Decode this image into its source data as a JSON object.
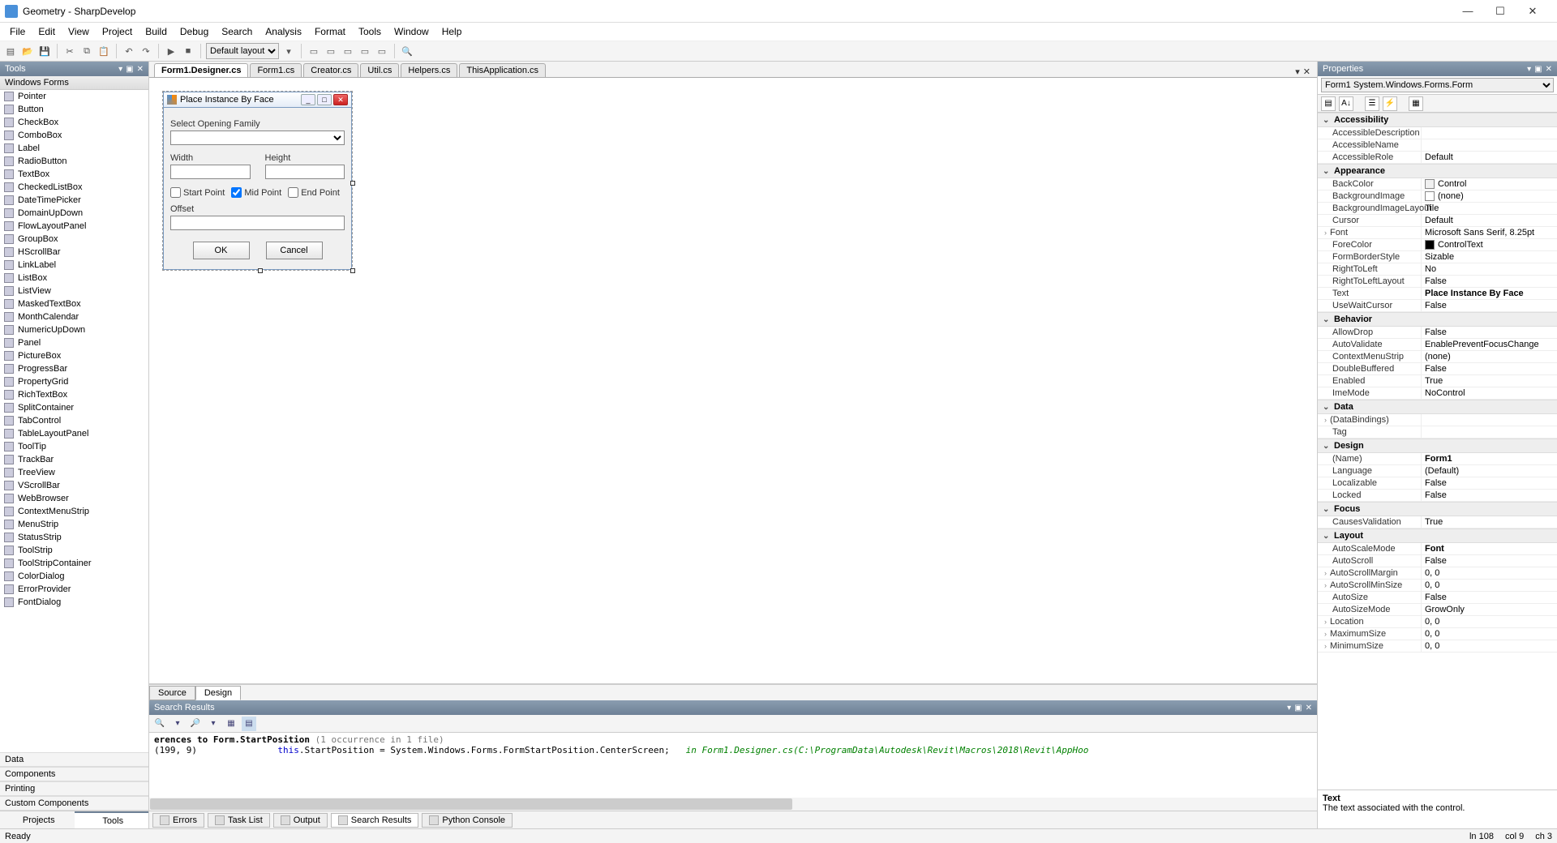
{
  "window": {
    "title": "Geometry - SharpDevelop"
  },
  "menu": [
    "File",
    "Edit",
    "View",
    "Project",
    "Build",
    "Debug",
    "Search",
    "Analysis",
    "Format",
    "Tools",
    "Window",
    "Help"
  ],
  "toolbar": {
    "layout": "Default layout"
  },
  "tools": {
    "header": "Tools",
    "subheader": "Windows Forms",
    "items": [
      "Pointer",
      "Button",
      "CheckBox",
      "ComboBox",
      "Label",
      "RadioButton",
      "TextBox",
      "CheckedListBox",
      "DateTimePicker",
      "DomainUpDown",
      "FlowLayoutPanel",
      "GroupBox",
      "HScrollBar",
      "LinkLabel",
      "ListBox",
      "ListView",
      "MaskedTextBox",
      "MonthCalendar",
      "NumericUpDown",
      "Panel",
      "PictureBox",
      "ProgressBar",
      "PropertyGrid",
      "RichTextBox",
      "SplitContainer",
      "TabControl",
      "TableLayoutPanel",
      "ToolTip",
      "TrackBar",
      "TreeView",
      "VScrollBar",
      "WebBrowser",
      "ContextMenuStrip",
      "MenuStrip",
      "StatusStrip",
      "ToolStrip",
      "ToolStripContainer",
      "ColorDialog",
      "ErrorProvider",
      "FontDialog"
    ],
    "sections": [
      "Data",
      "Components",
      "Printing",
      "Custom Components"
    ],
    "tab_projects": "Projects",
    "tab_tools": "Tools"
  },
  "tabs": {
    "files": [
      "Form1.Designer.cs",
      "Form1.cs",
      "Creator.cs",
      "Util.cs",
      "Helpers.cs",
      "ThisApplication.cs"
    ],
    "active": 0,
    "subtabs": {
      "source": "Source",
      "design": "Design",
      "active": "Design"
    }
  },
  "designer": {
    "title": "Place Instance By Face",
    "lbl_family": "Select Opening Family",
    "lbl_width": "Width",
    "lbl_height": "Height",
    "chk_start": "Start Point",
    "chk_mid": "Mid Point",
    "chk_end": "End Point",
    "lbl_offset": "Offset",
    "btn_ok": "OK",
    "btn_cancel": "Cancel"
  },
  "search": {
    "header": "Search Results",
    "line1_a": "erences to Form.StartPosition",
    "line1_b": " (1 occurrence in 1 file)",
    "line2_pos": "(199, 9)",
    "line2_code_a": "this",
    "line2_code_b": ".StartPosition = System.Windows.Forms.FormStartPosition.CenterScreen;",
    "line2_comment": "in Form1.Designer.cs(C:\\ProgramData\\Autodesk\\Revit\\Macros\\2018\\Revit\\AppHoo"
  },
  "bottomtabs": [
    "Errors",
    "Task List",
    "Output",
    "Search Results",
    "Python Console"
  ],
  "props": {
    "header": "Properties",
    "object": "Form1   System.Windows.Forms.Form",
    "help_title": "Text",
    "help_desc": "The text associated with the control.",
    "cats": {
      "Accessibility": [
        {
          "n": "AccessibleDescription",
          "v": ""
        },
        {
          "n": "AccessibleName",
          "v": ""
        },
        {
          "n": "AccessibleRole",
          "v": "Default"
        }
      ],
      "Appearance": [
        {
          "n": "BackColor",
          "v": "Control",
          "swatch": "#f0f0f0"
        },
        {
          "n": "BackgroundImage",
          "v": "(none)",
          "swatch": "#ffffff"
        },
        {
          "n": "BackgroundImageLayout",
          "v": "Tile"
        },
        {
          "n": "Cursor",
          "v": "Default"
        },
        {
          "n": "Font",
          "v": "Microsoft Sans Serif, 8.25pt",
          "exp": true
        },
        {
          "n": "ForeColor",
          "v": "ControlText",
          "swatch": "#000000"
        },
        {
          "n": "FormBorderStyle",
          "v": "Sizable"
        },
        {
          "n": "RightToLeft",
          "v": "No"
        },
        {
          "n": "RightToLeftLayout",
          "v": "False"
        },
        {
          "n": "Text",
          "v": "Place Instance By Face",
          "bold": true
        },
        {
          "n": "UseWaitCursor",
          "v": "False"
        }
      ],
      "Behavior": [
        {
          "n": "AllowDrop",
          "v": "False"
        },
        {
          "n": "AutoValidate",
          "v": "EnablePreventFocusChange"
        },
        {
          "n": "ContextMenuStrip",
          "v": "(none)"
        },
        {
          "n": "DoubleBuffered",
          "v": "False"
        },
        {
          "n": "Enabled",
          "v": "True"
        },
        {
          "n": "ImeMode",
          "v": "NoControl"
        }
      ],
      "Data": [
        {
          "n": "(DataBindings)",
          "v": "",
          "exp": true
        },
        {
          "n": "Tag",
          "v": ""
        }
      ],
      "Design": [
        {
          "n": "(Name)",
          "v": "Form1",
          "bold": true
        },
        {
          "n": "Language",
          "v": "(Default)"
        },
        {
          "n": "Localizable",
          "v": "False"
        },
        {
          "n": "Locked",
          "v": "False"
        }
      ],
      "Focus": [
        {
          "n": "CausesValidation",
          "v": "True"
        }
      ],
      "Layout": [
        {
          "n": "AutoScaleMode",
          "v": "Font",
          "bold": true
        },
        {
          "n": "AutoScroll",
          "v": "False"
        },
        {
          "n": "AutoScrollMargin",
          "v": "0, 0",
          "exp": true
        },
        {
          "n": "AutoScrollMinSize",
          "v": "0, 0",
          "exp": true
        },
        {
          "n": "AutoSize",
          "v": "False"
        },
        {
          "n": "AutoSizeMode",
          "v": "GrowOnly"
        },
        {
          "n": "Location",
          "v": "0, 0",
          "exp": true
        },
        {
          "n": "MaximumSize",
          "v": "0, 0",
          "exp": true
        },
        {
          "n": "MinimumSize",
          "v": "0, 0",
          "exp": true
        }
      ]
    }
  },
  "status": {
    "ready": "Ready",
    "ln": "ln 108",
    "col": "col 9",
    "ch": "ch 3"
  }
}
